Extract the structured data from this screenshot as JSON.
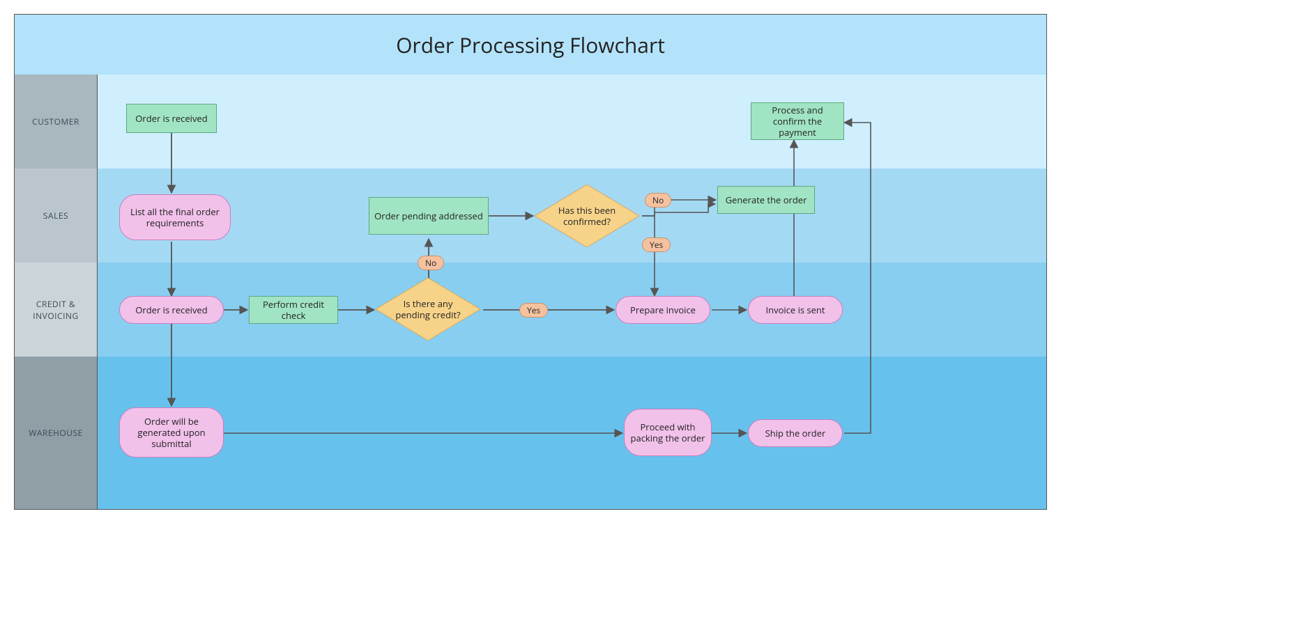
{
  "title": "Order Processing Flowchart",
  "lanes": {
    "customer": "CUSTOMER",
    "sales": "SALES",
    "credit": "CREDIT & INVOICING",
    "warehouse": "WAREHOUSE"
  },
  "nodes": {
    "order_received_customer": "Order is received",
    "list_requirements": "List all the final order requirements",
    "order_received_credit": "Order is received",
    "perform_credit_check": "Perform credit check",
    "pending_credit_decision": "Is there any pending credit?",
    "order_pending_addressed": "Order pending addressed",
    "confirmed_decision": "Has this been confirmed?",
    "generate_order": "Generate the order",
    "prepare_invoice": "Prepare invoice",
    "invoice_sent": "Invoice is sent",
    "process_payment": "Process and confirm the payment",
    "order_generated_submittal": "Order will be generated upon submittal",
    "proceed_packing": "Proceed with packing the order",
    "ship_order": "Ship the order"
  },
  "labels": {
    "yes": "Yes",
    "no": "No"
  },
  "colors": {
    "process": "#a1e4c3",
    "terminator": "#f1c1ea",
    "decision": "#f7d38a",
    "tag": "#f5c2a0"
  },
  "chart_data": {
    "type": "swimlane-flowchart",
    "title": "Order Processing Flowchart",
    "lanes": [
      "CUSTOMER",
      "SALES",
      "CREDIT & INVOICING",
      "WAREHOUSE"
    ],
    "nodes": [
      {
        "id": "n1",
        "lane": "CUSTOMER",
        "shape": "process",
        "label": "Order is received"
      },
      {
        "id": "n2",
        "lane": "SALES",
        "shape": "terminator",
        "label": "List all the final order requirements"
      },
      {
        "id": "n3",
        "lane": "CREDIT & INVOICING",
        "shape": "terminator",
        "label": "Order is received"
      },
      {
        "id": "n4",
        "lane": "CREDIT & INVOICING",
        "shape": "process",
        "label": "Perform credit check"
      },
      {
        "id": "n5",
        "lane": "CREDIT & INVOICING",
        "shape": "decision",
        "label": "Is there any pending credit?"
      },
      {
        "id": "n6",
        "lane": "SALES",
        "shape": "process",
        "label": "Order pending addressed"
      },
      {
        "id": "n7",
        "lane": "SALES",
        "shape": "decision",
        "label": "Has this been confirmed?"
      },
      {
        "id": "n8",
        "lane": "SALES",
        "shape": "process",
        "label": "Generate the order"
      },
      {
        "id": "n9",
        "lane": "CREDIT & INVOICING",
        "shape": "terminator",
        "label": "Prepare invoice"
      },
      {
        "id": "n10",
        "lane": "CREDIT & INVOICING",
        "shape": "terminator",
        "label": "Invoice is sent"
      },
      {
        "id": "n11",
        "lane": "CUSTOMER",
        "shape": "process",
        "label": "Process and confirm the payment"
      },
      {
        "id": "n12",
        "lane": "WAREHOUSE",
        "shape": "terminator",
        "label": "Order will be generated upon submittal"
      },
      {
        "id": "n13",
        "lane": "WAREHOUSE",
        "shape": "terminator",
        "label": "Proceed with packing the order"
      },
      {
        "id": "n14",
        "lane": "WAREHOUSE",
        "shape": "terminator",
        "label": "Ship the order"
      }
    ],
    "edges": [
      {
        "from": "n1",
        "to": "n2"
      },
      {
        "from": "n2",
        "to": "n3"
      },
      {
        "from": "n3",
        "to": "n4"
      },
      {
        "from": "n3",
        "to": "n12"
      },
      {
        "from": "n4",
        "to": "n5"
      },
      {
        "from": "n5",
        "to": "n6",
        "label": "No"
      },
      {
        "from": "n5",
        "to": "n9",
        "label": "Yes"
      },
      {
        "from": "n6",
        "to": "n7"
      },
      {
        "from": "n7",
        "to": "n8",
        "label": "No"
      },
      {
        "from": "n7",
        "to": "n9",
        "label": "Yes"
      },
      {
        "from": "n9",
        "to": "n10"
      },
      {
        "from": "n10",
        "to": "n11"
      },
      {
        "from": "n12",
        "to": "n13"
      },
      {
        "from": "n13",
        "to": "n14"
      },
      {
        "from": "n14",
        "to": "n11"
      }
    ]
  }
}
